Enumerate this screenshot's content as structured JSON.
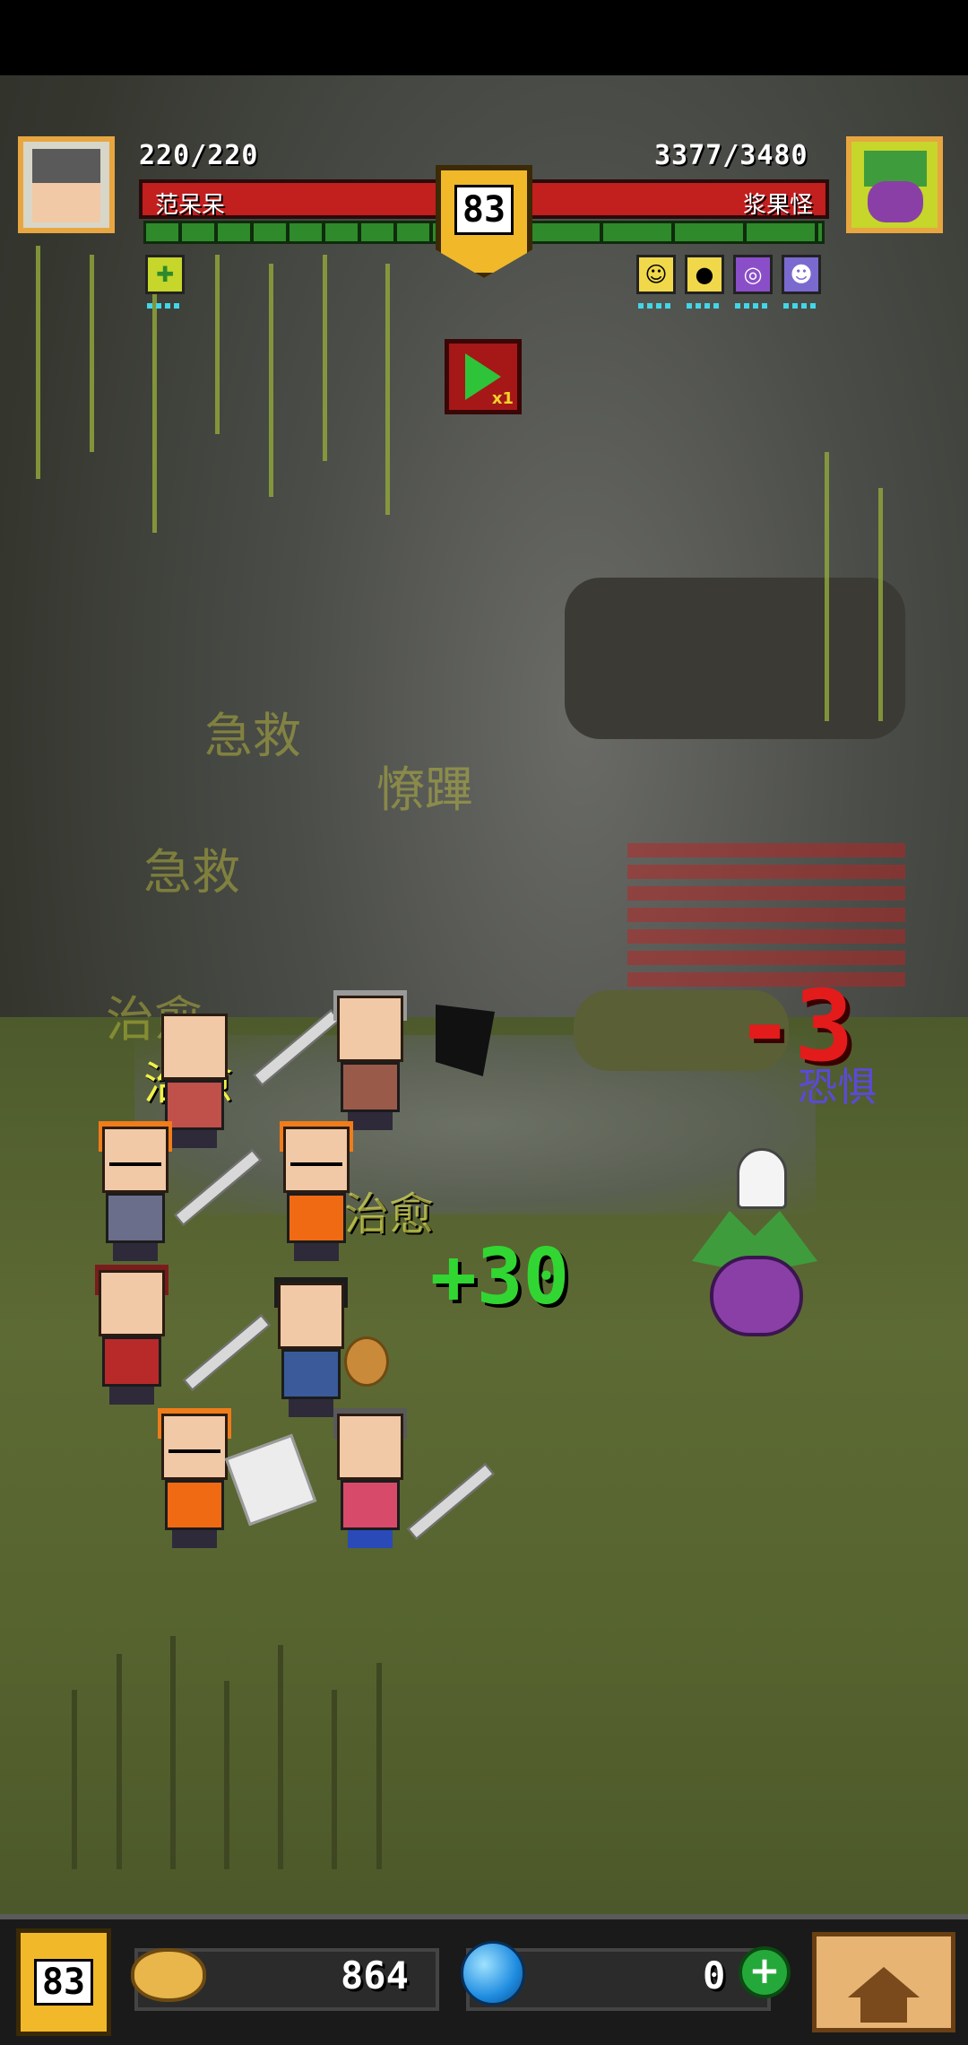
{
  "player": {
    "hp": "220/220",
    "name": "范呆呆"
  },
  "enemy": {
    "hp": "3377/3480",
    "name": "浆果怪"
  },
  "stage_level": "83",
  "speed": {
    "label": "x1"
  },
  "combat_log": {
    "fading": [
      "急救",
      "急救",
      "治愈",
      "憭蹕"
    ],
    "heal_labels": [
      "治愈",
      "治愈"
    ],
    "heal_amount": "+30",
    "enemy_damage": "-3",
    "enemy_status": "恐惧"
  },
  "bottom_bar": {
    "level": "83",
    "coins": "864",
    "gems": "0",
    "plus_label": "+"
  },
  "colors": {
    "hp_red": "#c21f1f",
    "energy_green": "#2e8a2a",
    "badge_gold": "#f1b82a",
    "heal_green": "#32d632"
  }
}
